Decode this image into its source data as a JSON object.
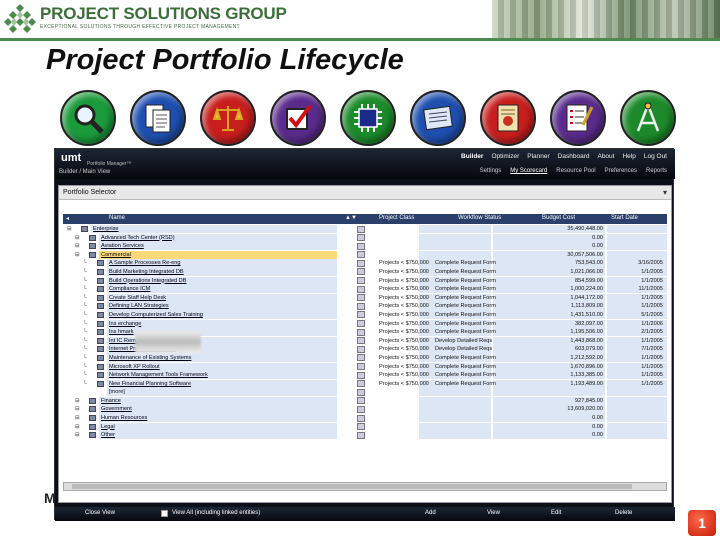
{
  "banner": {
    "company": "PROJECT SOLUTIONS GROUP",
    "tagline": "EXCEPTIONAL SOLUTIONS THROUGH EFFECTIVE PROJECT MANAGEMENT"
  },
  "slide": {
    "title": "Project Portfolio Lifecycle",
    "page_number": "1",
    "side_fragment": "M"
  },
  "icons": [
    {
      "icon": "magnifier-icon",
      "color": "#1a9a3a"
    },
    {
      "icon": "documents-icon",
      "color": "#1e4fb0"
    },
    {
      "icon": "scales-icon",
      "color": "#c81e1e"
    },
    {
      "icon": "checkbox-icon",
      "color": "#5a2b8c"
    },
    {
      "icon": "chip-icon",
      "color": "#1c8a2a"
    },
    {
      "icon": "blueprint-icon",
      "color": "#1e4fb0"
    },
    {
      "icon": "certificate-icon",
      "color": "#c81e1e"
    },
    {
      "icon": "checklist-icon",
      "color": "#5a2b8c"
    },
    {
      "icon": "compass-icon",
      "color": "#1c8a2a"
    }
  ],
  "app": {
    "brand": "umt",
    "brand_sub": "Portfolio Manager™",
    "nav": [
      "Builder",
      "Optimizer",
      "Planner",
      "Dashboard",
      "About",
      "Help",
      "Log Out"
    ],
    "active_nav": "Builder",
    "subnav": [
      "Settings",
      "My Scorecard",
      "Resource Pool",
      "Preferences",
      "Reports"
    ],
    "active_subnav": "My Scorecard",
    "breadcrumb": "Builder / Main View",
    "panel_title": "Portfolio Selector",
    "columns": [
      "Name",
      "Project Class",
      "Workflow Status",
      "Budget Cost",
      "Start Date"
    ],
    "rows": [
      {
        "name": "Enterprise",
        "class": "",
        "status": "",
        "cost": "35,490,448.00",
        "start": "",
        "level": 0
      },
      {
        "name": "Advanced Tech Center (RSD)",
        "class": "",
        "status": "",
        "cost": "0.00",
        "start": "",
        "level": 1
      },
      {
        "name": "Aviation Services",
        "class": "",
        "status": "",
        "cost": "0.00",
        "start": "",
        "level": 1
      },
      {
        "name": "Commercial",
        "class": "",
        "status": "",
        "cost": "30,057,506.00",
        "start": "",
        "level": 1,
        "selected": true
      },
      {
        "name": "A Sample Processes Re-eng",
        "class": "Projects < $750,000",
        "status": "Complete Request Form",
        "cost": "753,543.00",
        "start": "3/16/2005",
        "level": 2
      },
      {
        "name": "Build Marketing Integrated DB",
        "class": "Projects < $750,000",
        "status": "Complete Request Form",
        "cost": "1,021,066.00",
        "start": "1/1/2005",
        "level": 2
      },
      {
        "name": "Build Operations Integrated DB",
        "class": "Projects < $750,000",
        "status": "Complete Request Form",
        "cost": "854,599.00",
        "start": "1/1/2005",
        "level": 2
      },
      {
        "name": "Compliance ICM",
        "class": "Projects < $750,000",
        "status": "Complete Request Form",
        "cost": "1,000,224.00",
        "start": "11/1/2005",
        "level": 2
      },
      {
        "name": "Create Staff Help Desk",
        "class": "Projects < $750,000",
        "status": "Complete Request Form",
        "cost": "1,044,172.00",
        "start": "1/1/2005",
        "level": 2
      },
      {
        "name": "Defining LAN Strategies",
        "class": "Projects < $750,000",
        "status": "Complete Request Form",
        "cost": "1,113,809.00",
        "start": "1/1/2005",
        "level": 2
      },
      {
        "name": "Develop Computerized Sales Training",
        "class": "Projects < $750,000",
        "status": "Complete Request Form",
        "cost": "1,431,510.00",
        "start": "5/1/2005",
        "level": 2
      },
      {
        "name": "Ins erchange",
        "class": "Projects < $750,000",
        "status": "Complete Request Form",
        "cost": "382,097.00",
        "start": "1/1/2006",
        "level": 2
      },
      {
        "name": "Ins hmark",
        "class": "Projects < $750,000",
        "status": "Complete Request Form",
        "cost": "1,195,506.00",
        "start": "2/1/2005",
        "level": 2
      },
      {
        "name": "Int  IC Rem Acc VPN",
        "class": "Projects < $750,000",
        "status": "Develop Detailed Reqs",
        "cost": "1,443,868.00",
        "start": "1/1/2005",
        "level": 2
      },
      {
        "name": "Internet Presence Program",
        "class": "Projects < $750,000",
        "status": "Develop Detailed Reqs",
        "cost": "603,079.00",
        "start": "7/1/2005",
        "level": 2
      },
      {
        "name": "Maintenance of Existing Systems",
        "class": "Projects < $750,000",
        "status": "Complete Request Form",
        "cost": "1,212,592.00",
        "start": "1/1/2005",
        "level": 2
      },
      {
        "name": "Microsoft XP Rollout",
        "class": "Projects < $750,000",
        "status": "Complete Request Form",
        "cost": "1,670,896.00",
        "start": "1/1/2005",
        "level": 2
      },
      {
        "name": "Network Management Tools Framework",
        "class": "Projects < $750,000",
        "status": "Complete Request Form",
        "cost": "1,133,385.00",
        "start": "1/1/2005",
        "level": 2
      },
      {
        "name": "New Financial Planning Software",
        "class": "Projects < $750,000",
        "status": "Complete Request Form",
        "cost": "1,193,489.00",
        "start": "1/1/2005",
        "level": 2
      },
      {
        "name": "[more]",
        "class": "",
        "status": "",
        "cost": "",
        "start": "",
        "level": 2,
        "plain": true
      },
      {
        "name": "Finance",
        "class": "",
        "status": "",
        "cost": "927,845.00",
        "start": "",
        "level": 1
      },
      {
        "name": "Government",
        "class": "",
        "status": "",
        "cost": "13,609,020.00",
        "start": "",
        "level": 1
      },
      {
        "name": "Human Resources",
        "class": "",
        "status": "",
        "cost": "0.00",
        "start": "",
        "level": 1
      },
      {
        "name": "Legal",
        "class": "",
        "status": "",
        "cost": "0.00",
        "start": "",
        "level": 1
      },
      {
        "name": "Other",
        "class": "",
        "status": "",
        "cost": "0.00",
        "start": "",
        "level": 1
      }
    ],
    "footer": {
      "close_view": "Close View",
      "view_all": "View All (including linked entities)",
      "add": "Add",
      "view": "View",
      "edit": "Edit",
      "delete": "Delete"
    }
  }
}
